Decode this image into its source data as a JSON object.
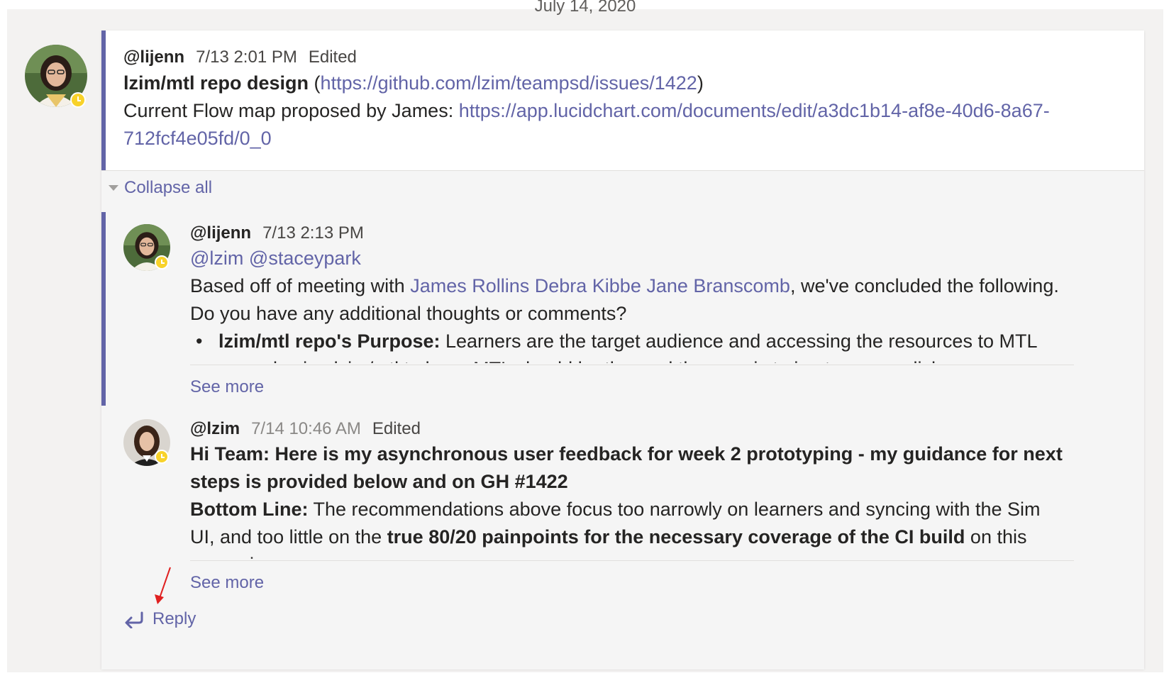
{
  "date_divider": "July 14, 2020",
  "colors": {
    "accent": "#6264a7",
    "status_away": "#f8d22a",
    "annotation": "#e02020"
  },
  "root": {
    "author": "@lijenn",
    "timestamp": "7/13 2:01 PM",
    "edited": "Edited",
    "title_bold": "lzim/mtl repo design",
    "title_open": " (",
    "title_link": "https://github.com/lzim/teampsd/issues/1422",
    "title_close": ")",
    "flow_prefix": "Current Flow map proposed by James: ",
    "flow_link_1": "https://app.lucidchart.com/documents/edit/a3dc1b14-af8e-40d6-8a67-",
    "flow_link_2": "712fcf4e05fd/0_0"
  },
  "collapse_label": "Collapse all",
  "reply1": {
    "author": "@lijenn",
    "timestamp": "7/13 2:13 PM",
    "mention_1": "@lzim",
    "mention_2": "@staceypark",
    "line1_prefix": "Based off of meeting with ",
    "line1_people": "James Rollins Debra Kibbe Jane Branscomb",
    "line1_suffix": ", we've concluded the following.",
    "line2": "Do you have any additional thoughts or comments?",
    "bullet_bold": "lzim/mtl repo's Purpose:",
    "bullet_text": " Learners are the target audience and accessing the resources to MTL",
    "bullet_cut": "and using lzim/mtl to learn MTL should be the goal the repo is trying to accomplish",
    "see_more": "See more"
  },
  "reply2": {
    "author": "@lzim",
    "timestamp": "7/14 10:46 AM",
    "edited": "Edited",
    "headline_1": "Hi Team: Here is my asynchronous user feedback for week 2 prototyping - my guidance for next",
    "headline_2": "steps is provided below and on GH #1422",
    "bottom_label": "Bottom Line:",
    "bottom_text": " The recommendations above focus too narrowly on learners and syncing with the Sim",
    "line_b_prefix": "UI, and too little on the ",
    "line_b_bold": "true 80/20 painpoints for the necessary coverage of the CI build",
    "line_b_suffix": " on this",
    "line_cut": "repo, given:",
    "see_more": "See more"
  },
  "reply_action": {
    "icon": "reply-arrow-icon",
    "label": "Reply"
  }
}
